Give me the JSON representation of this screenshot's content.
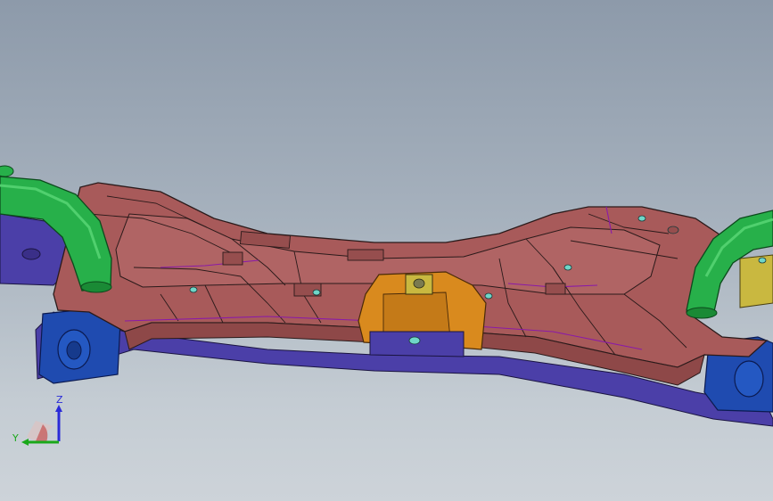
{
  "viewport": {
    "background_top": "#8d9aaa",
    "background_bottom": "#cdd3d9"
  },
  "model": {
    "colors": {
      "subframe_body": "#a85a5a",
      "subframe_shade": "#8e4848",
      "edge_lines": "#2a1a1a",
      "feature_lines": "#8a1aa8",
      "tube": "#27b04a",
      "tube_shade": "#1a8a35",
      "mount_blue": "#1f4bb0",
      "mount_purple": "#4b3fa8",
      "bracket_orange": "#d98a1e",
      "bracket_yellow": "#c9b840",
      "hole_cyan": "#6fd6c8"
    }
  },
  "triad": {
    "z_label": "Z",
    "y_label": "Y",
    "z_color": "#2a2ad8",
    "y_color": "#1aa81a",
    "x_color": "#d02020"
  }
}
